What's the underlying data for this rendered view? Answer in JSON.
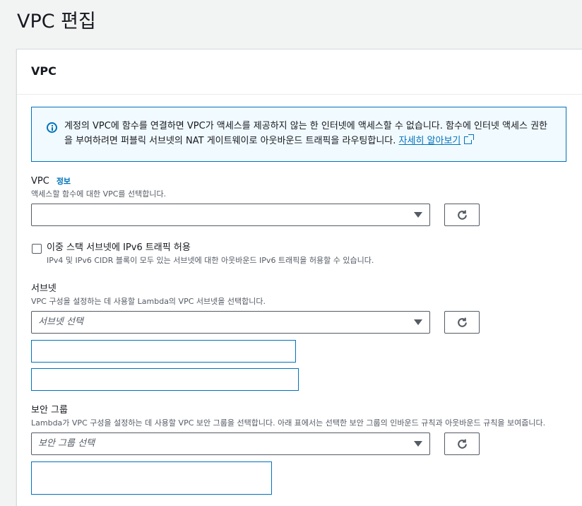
{
  "page": {
    "title": "VPC 편집"
  },
  "panel": {
    "title": "VPC"
  },
  "alert": {
    "text": "계정의 VPC에 함수를 연결하면 VPC가 액세스를 제공하지 않는 한 인터넷에 액세스할 수 없습니다. 함수에 인터넷 액세스 권한을 부여하려면 퍼블릭 서브넷의 NAT 게이트웨이로 아웃바운드 트래픽을 라우팅합니다.",
    "link_text": "자세히 알아보기",
    "icon": "info-icon",
    "link_icon": "external-link-icon"
  },
  "vpc": {
    "label": "VPC",
    "info": "정보",
    "description": "액세스할 함수에 대한 VPC를 선택합니다.",
    "value": "",
    "refresh_icon": "refresh-icon"
  },
  "ipv6": {
    "checked": false,
    "label": "이중 스택 서브넷에 IPv6 트래픽 허용",
    "description": "IPv4 및 IPv6 CIDR 블록이 모두 있는 서브넷에 대한 아웃바운드 IPv6 트래픽을 허용할 수 있습니다."
  },
  "subnets": {
    "label": "서브넷",
    "description": "VPC 구성을 설정하는 데 사용할 Lambda의 VPC 서브넷을 선택합니다.",
    "placeholder": "서브넷 선택"
  },
  "security_groups": {
    "label": "보안 그룹",
    "description": "Lambda가 VPC 구성을 설정하는 데 사용할 VPC 보안 그룹을 선택합니다. 아래 표에서는 선택한 보안 그룹의 인바운드 규칙과 아웃바운드 규칙을 보여줍니다.",
    "placeholder": "보안 그룹 선택"
  },
  "colors": {
    "accent": "#0073bb",
    "border": "#545b64",
    "background": "#f2f3f3",
    "alert_bg": "#f1faff"
  }
}
